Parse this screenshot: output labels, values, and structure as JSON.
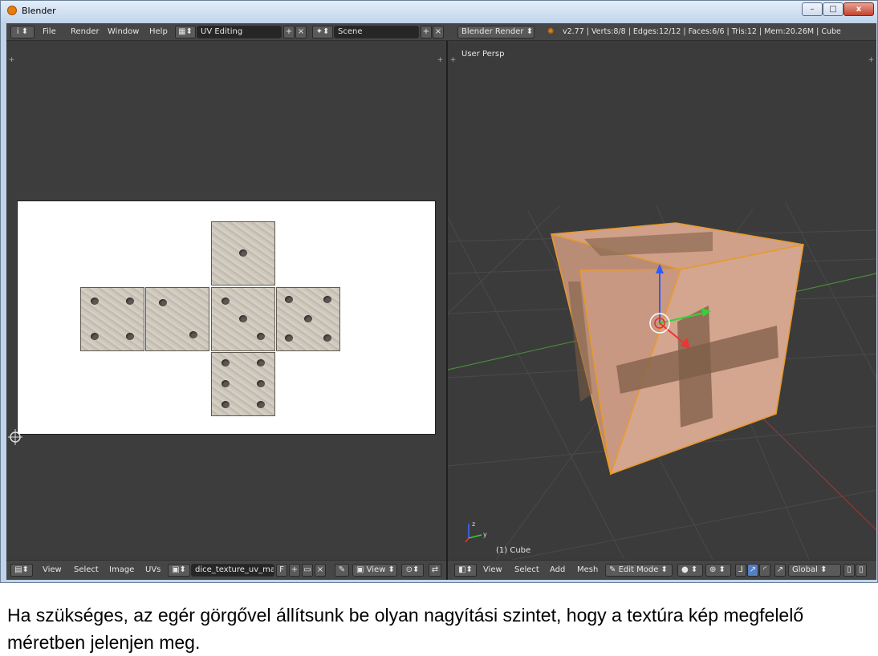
{
  "window": {
    "title": "Blender",
    "min_label": "–",
    "max_label": "□",
    "close_label": "x"
  },
  "topbar": {
    "info_icon": "i",
    "menu": [
      "File",
      "Render",
      "Window",
      "Help"
    ],
    "screen_layout": "UV Editing",
    "scene": "Scene",
    "render_engine": "Blender Render",
    "stats": "v2.77 | Verts:8/8 | Edges:12/12 | Faces:6/6 | Tris:12 | Mem:20.26M | Cube"
  },
  "uv_editor": {
    "menu": [
      "View",
      "Select",
      "Image",
      "UVs"
    ],
    "image_name": "dice_texture_uv_ma...",
    "fake_user": "F",
    "view_label": "View"
  },
  "viewport": {
    "view_label": "User Persp",
    "object_label": "(1) Cube",
    "menu": [
      "View",
      "Select",
      "Add",
      "Mesh"
    ],
    "mode": "Edit Mode",
    "orientation": "Global",
    "axis_z": "z",
    "axis_y": "y"
  },
  "caption": "Ha szükséges, az egér görgővel állítsunk be olyan nagyítási szintet, hogy a textúra kép megfelelő méretben jelenjen meg."
}
